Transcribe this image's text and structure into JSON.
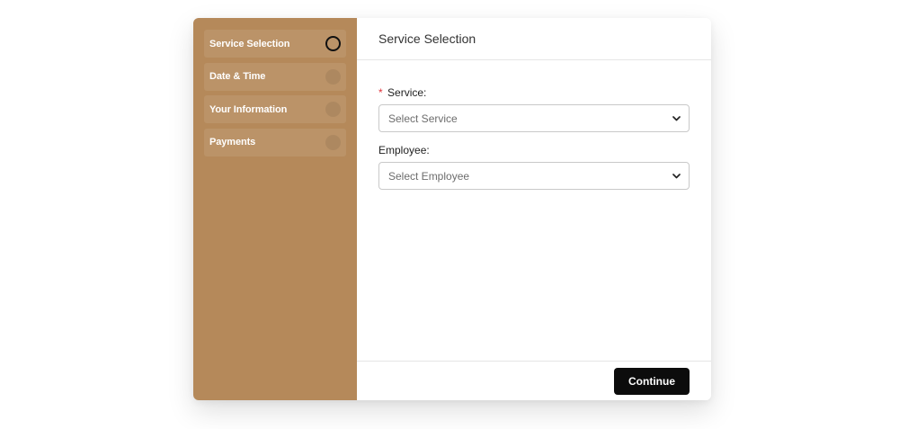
{
  "sidebar": {
    "steps": [
      {
        "label": "Service Selection",
        "active": true
      },
      {
        "label": "Date & Time",
        "active": false
      },
      {
        "label": "Your Information",
        "active": false
      },
      {
        "label": "Payments",
        "active": false
      }
    ]
  },
  "main": {
    "title": "Service Selection",
    "service": {
      "required_marker": "*",
      "label": "Service:",
      "selected": "Select Service"
    },
    "employee": {
      "label": "Employee:",
      "selected": "Select Employee"
    },
    "continue_label": "Continue"
  },
  "colors": {
    "sidebar_bg": "#b5895a",
    "button_bg": "#0c0c0c",
    "required": "#e0323a"
  },
  "icons": {
    "step_active": "ring-icon",
    "step_inactive": "dot-icon",
    "select_arrow": "chevron-down-icon"
  }
}
